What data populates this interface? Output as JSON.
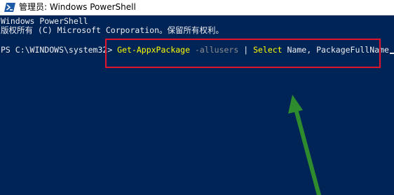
{
  "window": {
    "title": "管理员: Windows PowerShell",
    "icon": "powershell-icon"
  },
  "console": {
    "line1": "Windows PowerShell",
    "line2": "版权所有 (C) Microsoft Corporation。保留所有权利。",
    "prompt": "PS C:\\WINDOWS\\system32> ",
    "command": {
      "cmdlet": "Get-AppxPackage",
      "param": " -allusers",
      "pipe": " | ",
      "select": "Select",
      "args": " Name, PackageFullName"
    }
  },
  "colors": {
    "background": "#012456",
    "text": "#eeedf0",
    "command": "#ffff00",
    "parameter": "#8f8f8f",
    "highlight_box": "#e0142a",
    "arrow": "#2e8b2e"
  }
}
